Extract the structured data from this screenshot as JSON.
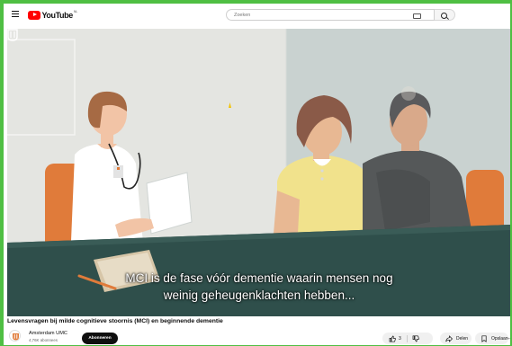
{
  "header": {
    "logo_text": "YouTube",
    "country_code": "NL",
    "search_placeholder": "Zoeken"
  },
  "video": {
    "subtitle_line1": "MCI is de fase vóór dementie waarin mensen nog",
    "subtitle_line2": "weinig geheugenklachten hebben...",
    "title": "Levensvragen bij milde cognitieve stoornis (MCI) en beginnende dementie"
  },
  "channel": {
    "name": "Amsterdam UMC",
    "subscribers": "4,76K abonnees",
    "subscribe_label": "Abonneren"
  },
  "actions": {
    "like_count": "3",
    "share_label": "Delen",
    "save_label": "Opslaan",
    "more_label": "..."
  },
  "colors": {
    "brand_red": "#ff0000",
    "page_border_green": "#4fbf43",
    "table_teal": "#2f4f4b",
    "chair_orange": "#e07b3a"
  }
}
